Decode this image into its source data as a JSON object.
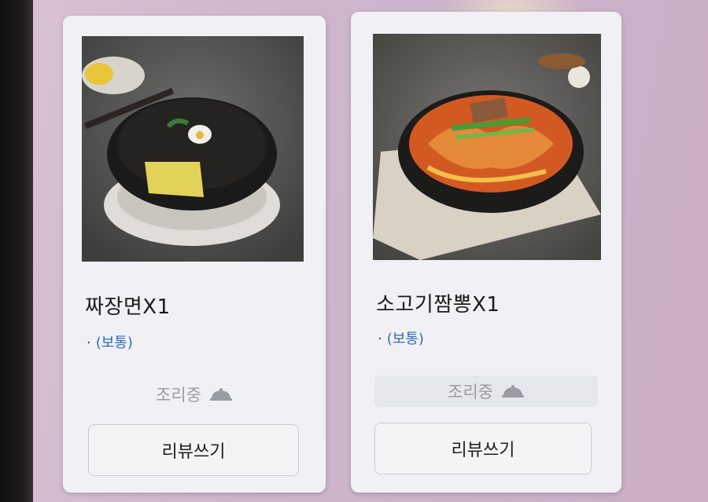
{
  "orders": [
    {
      "name": "짜장면X1",
      "option_bullet": "·",
      "option": "(보통)",
      "status": "조리중",
      "status_icon": "cloche-icon",
      "review_label": "리뷰쓰기",
      "photo": "jjajangmyeon-photo"
    },
    {
      "name": "소고기짬뽕X1",
      "option_bullet": "·",
      "option": "(보통)",
      "status": "조리중",
      "status_icon": "cloche-icon",
      "review_label": "리뷰쓰기",
      "photo": "beef-jjamppong-photo"
    }
  ],
  "colors": {
    "option_text": "#2e6bb5",
    "status_text": "#9a9ca4",
    "card_bg": "#f1f1f5"
  }
}
